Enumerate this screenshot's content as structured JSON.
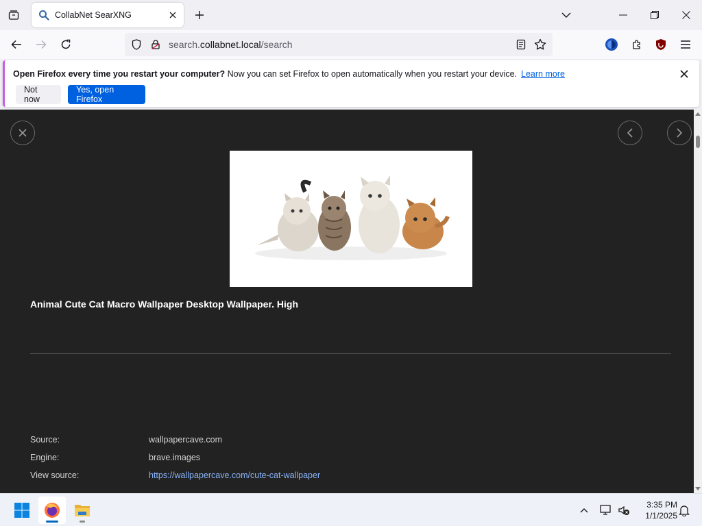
{
  "browser": {
    "tab": {
      "title": "CollabNet SearXNG"
    },
    "url": {
      "prefix": "search.",
      "host": "collabnet.local",
      "path": "/search"
    }
  },
  "notification": {
    "bold": "Open Firefox every time you restart your computer?",
    "text": " Now you can set Firefox to open automatically when you restart your device.",
    "link": "Learn more",
    "not_now": "Not now",
    "yes": "Yes, open Firefox"
  },
  "viewer": {
    "title": "Animal Cute Cat Macro Wallpaper Desktop Wallpaper. High",
    "details": [
      {
        "label": "Source:",
        "value": "wallpapercave.com"
      },
      {
        "label": "Engine:",
        "value": "brave.images"
      },
      {
        "label": "View source:",
        "value": "https://wallpapercave.com/cute-cat-wallpaper"
      }
    ]
  },
  "taskbar": {
    "time": "3:35 PM",
    "date": "1/1/2025"
  },
  "colors": {
    "accent": "#0061e0",
    "viewer_bg": "#222222",
    "link": "#8ab4f8"
  }
}
